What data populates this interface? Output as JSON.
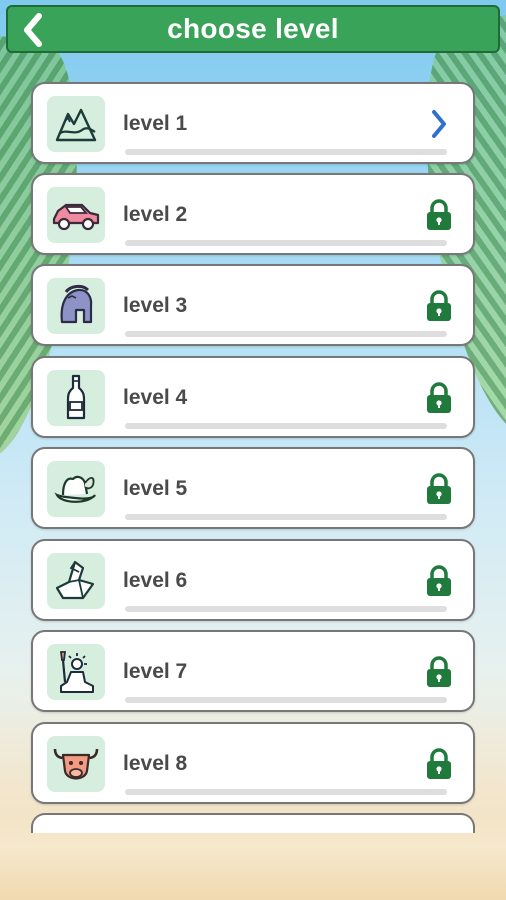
{
  "header": {
    "title": "choose level",
    "back_icon": "chevron-left-icon"
  },
  "colors": {
    "accent": "#3aa35a",
    "lock": "#1f7a3c",
    "arrow": "#2f6fd0",
    "card_border": "#777777",
    "icon_bg": "#d5eedd"
  },
  "levels": [
    {
      "label": "level 1",
      "icon": "mountains-icon",
      "status": "unlocked",
      "progress": 0
    },
    {
      "label": "level 2",
      "icon": "car-icon",
      "status": "locked",
      "progress": 0
    },
    {
      "label": "level 3",
      "icon": "spartan-helmet-icon",
      "status": "locked",
      "progress": 0
    },
    {
      "label": "level 4",
      "icon": "bottle-icon",
      "status": "locked",
      "progress": 0
    },
    {
      "label": "level 5",
      "icon": "hat-icon",
      "status": "locked",
      "progress": 0
    },
    {
      "label": "level 6",
      "icon": "origami-bird-icon",
      "status": "locked",
      "progress": 0
    },
    {
      "label": "level 7",
      "icon": "statue-of-liberty-icon",
      "status": "locked",
      "progress": 0
    },
    {
      "label": "level 8",
      "icon": "bull-icon",
      "status": "locked",
      "progress": 0
    }
  ]
}
